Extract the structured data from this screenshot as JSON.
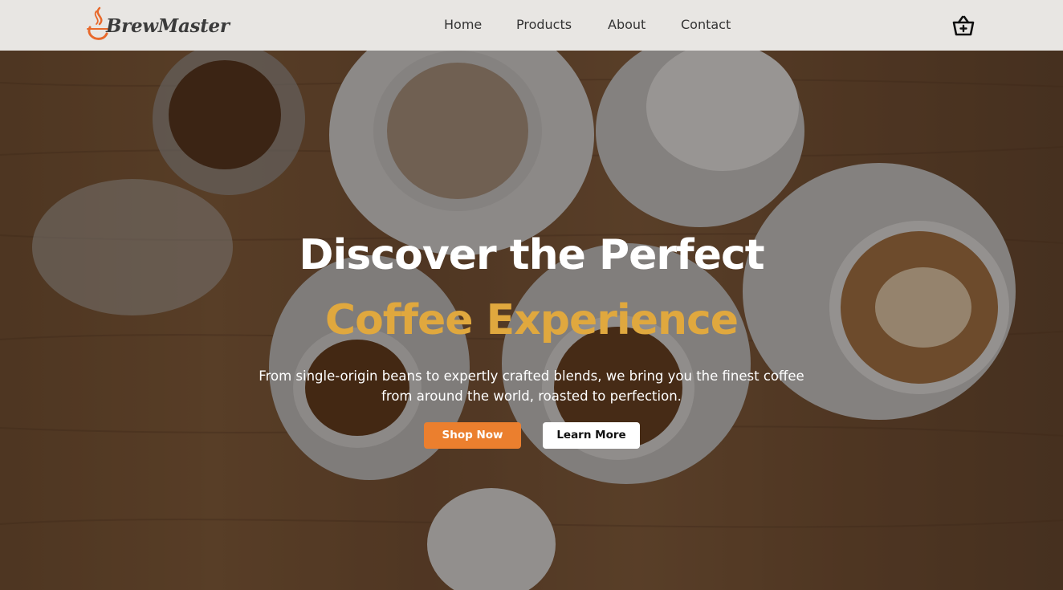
{
  "brand": {
    "name": "BrewMaster",
    "logo_icon": "coffee-flame-icon",
    "accent_color": "#e8692b"
  },
  "nav": {
    "items": [
      {
        "label": "Home"
      },
      {
        "label": "Products"
      },
      {
        "label": "About"
      },
      {
        "label": "Contact"
      }
    ],
    "cart_icon": "shopping-basket-icon"
  },
  "hero": {
    "title_line1": "Discover the Perfect",
    "title_line2": "Coffee Experience",
    "title_line2_color": "#e0a83e",
    "subtitle": "From single-origin beans to expertly crafted blends, we bring you the finest coffee from around the world, roasted to perfection.",
    "primary_button": {
      "label": "Shop Now",
      "color": "#eb7f2e"
    },
    "secondary_button": {
      "label": "Learn More",
      "color": "#ffffff"
    }
  }
}
